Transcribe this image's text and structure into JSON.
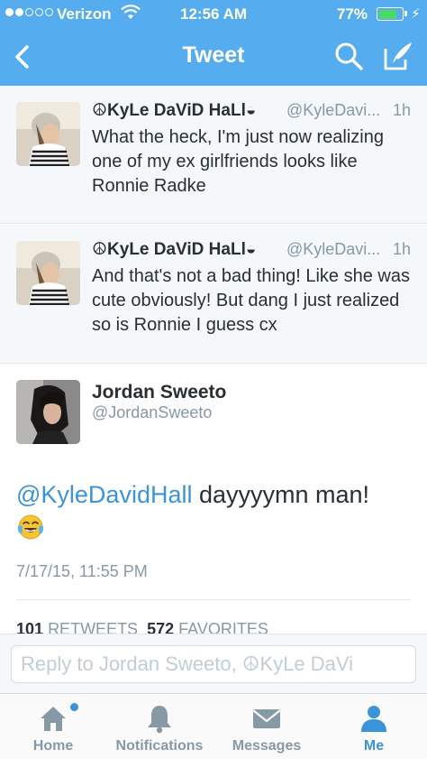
{
  "status": {
    "carrier": "Verizon",
    "time": "12:56 AM",
    "battery": "77%",
    "battery_level": 0.77
  },
  "nav": {
    "title": "Tweet"
  },
  "context_tweets": [
    {
      "name": "☮KyLe DaViD HaLl◒",
      "handle": "@KyleDavi...",
      "time": "1h",
      "text": "What the heck, I'm just now realizing one of my ex girlfriends looks like Ronnie Radke"
    },
    {
      "name": "☮KyLe DaViD HaLl◒",
      "handle": "@KyleDavi...",
      "time": "1h",
      "text": "And that's not a bad thing! Like she was cute obviously! But dang I just realized so is Ronnie I guess cx"
    }
  ],
  "main_tweet": {
    "name": "Jordan Sweeto",
    "handle": "@JordanSweeto",
    "mention": "@KyleDavidHall",
    "text": " dayyyymn man!",
    "date": "7/17/15, 11:55 PM",
    "retweets": "101",
    "retweets_label": "RETWEETS",
    "favorites": "572",
    "favorites_label": "FAVORITES"
  },
  "reply": {
    "placeholder": "Reply to Jordan Sweeto, ☮KyLe DaVi"
  },
  "tabs": [
    {
      "label": "Home",
      "icon": "home-icon"
    },
    {
      "label": "Notifications",
      "icon": "bell-icon"
    },
    {
      "label": "Messages",
      "icon": "envelope-icon"
    },
    {
      "label": "Me",
      "icon": "person-icon"
    }
  ],
  "colors": {
    "brand": "#55acee",
    "link": "#3b94d9",
    "muted": "#8899a6"
  }
}
